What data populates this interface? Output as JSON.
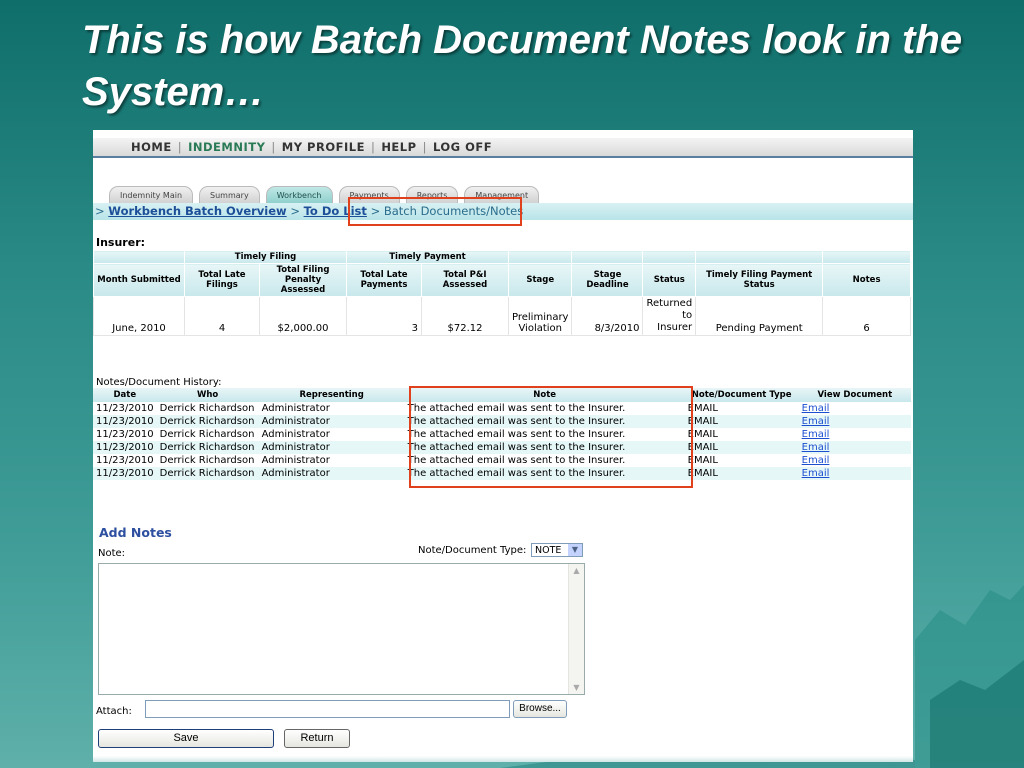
{
  "slide": {
    "title": "This is how Batch Document Notes look in the System…"
  },
  "topnav": {
    "items": [
      "HOME",
      "INDEMNITY",
      "MY PROFILE",
      "HELP",
      "LOG OFF"
    ],
    "active": "INDEMNITY"
  },
  "tabs": [
    "Indemnity Main",
    "Summary",
    "Workbench",
    "Payments",
    "Reports",
    "Management"
  ],
  "active_tab": "Workbench",
  "breadcrumb": {
    "prefix": ">",
    "link1": "Workbench Batch Overview",
    "sep": ">",
    "link2": "To Do List",
    "current": "Batch Documents/Notes"
  },
  "summary": {
    "label": "Insurer:",
    "group_headers": {
      "timely_filing": "Timely Filing",
      "timely_payment": "Timely Payment"
    },
    "columns": [
      "Month Submitted",
      "Total Late Filings",
      "Total Filing Penalty Assessed",
      "Total Late Payments",
      "Total P&I Assessed",
      "Stage",
      "Stage Deadline",
      "Status",
      "Timely Filing Payment Status",
      "Notes"
    ],
    "row": {
      "month": "June, 2010",
      "late_filings": "4",
      "filing_penalty": "$2,000.00",
      "late_payments": "3",
      "pi_assessed": "$72.12",
      "stage": "Preliminary Violation",
      "stage_deadline": "8/3/2010",
      "status": "Returned to Insurer",
      "tf_payment_status": "Pending Payment",
      "notes": "6"
    }
  },
  "history": {
    "label": "Notes/Document History:",
    "columns": [
      "Date",
      "Who",
      "Representing",
      "Note",
      "Note/Document Type",
      "View Document"
    ],
    "rows": [
      {
        "date": "11/23/2010",
        "who": "Derrick Richardson",
        "representing": "Administrator",
        "note": "The attached email was sent to the Insurer.",
        "type": "EMAIL",
        "view": "Email"
      },
      {
        "date": "11/23/2010",
        "who": "Derrick Richardson",
        "representing": "Administrator",
        "note": "The attached email was sent to the Insurer.",
        "type": "EMAIL",
        "view": "Email"
      },
      {
        "date": "11/23/2010",
        "who": "Derrick Richardson",
        "representing": "Administrator",
        "note": "The attached email was sent to the Insurer.",
        "type": "EMAIL",
        "view": "Email"
      },
      {
        "date": "11/23/2010",
        "who": "Derrick Richardson",
        "representing": "Administrator",
        "note": "The attached email was sent to the Insurer.",
        "type": "EMAIL",
        "view": "Email"
      },
      {
        "date": "11/23/2010",
        "who": "Derrick Richardson",
        "representing": "Administrator",
        "note": "The attached email was sent to the Insurer.",
        "type": "EMAIL",
        "view": "Email"
      },
      {
        "date": "11/23/2010",
        "who": "Derrick Richardson",
        "representing": "Administrator",
        "note": "The attached email was sent to the Insurer.",
        "type": "EMAIL",
        "view": "Email"
      }
    ]
  },
  "add_notes": {
    "heading": "Add Notes",
    "note_label": "Note:",
    "type_label": "Note/Document Type:",
    "type_value": "NOTE",
    "note_value": "",
    "attach_label": "Attach:",
    "attach_value": "",
    "browse_label": "Browse...",
    "save_label": "Save",
    "return_label": "Return"
  },
  "colors": {
    "background": "#2a8a86",
    "highlight_box": "#e0401b",
    "link": "#1c4fd0",
    "heading_blue": "#2d4fa0"
  }
}
